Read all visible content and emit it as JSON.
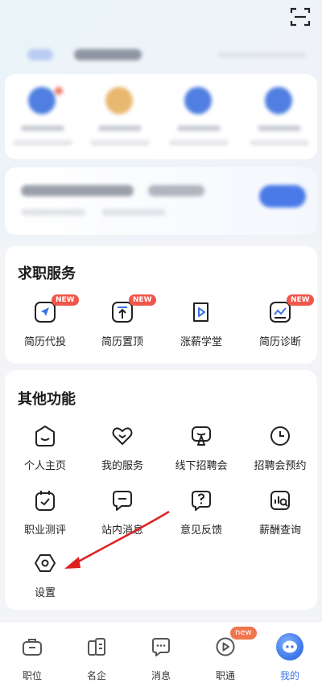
{
  "header": {
    "scan_icon": "scan-icon"
  },
  "service_section": {
    "title": "求职服务",
    "items": [
      {
        "label": "简历代投",
        "icon": "send-icon",
        "badge": "NEW"
      },
      {
        "label": "简历置顶",
        "icon": "pin-top-icon",
        "badge": "NEW"
      },
      {
        "label": "涨薪学堂",
        "icon": "play-book-icon",
        "badge": ""
      },
      {
        "label": "简历诊断",
        "icon": "diagnosis-icon",
        "badge": "NEW"
      }
    ]
  },
  "other_section": {
    "title": "其他功能",
    "items": [
      {
        "label": "个人主页",
        "icon": "home-face-icon"
      },
      {
        "label": "我的服务",
        "icon": "heart-icon"
      },
      {
        "label": "线下招聘会",
        "icon": "booth-icon"
      },
      {
        "label": "招聘会预约",
        "icon": "clock-icon"
      },
      {
        "label": "职业测评",
        "icon": "calendar-check-icon"
      },
      {
        "label": "站内消息",
        "icon": "message-icon"
      },
      {
        "label": "意见反馈",
        "icon": "question-icon"
      },
      {
        "label": "薪酬查询",
        "icon": "salary-search-icon"
      },
      {
        "label": "设置",
        "icon": "settings-icon"
      }
    ]
  },
  "tabbar": {
    "tabs": [
      {
        "label": "职位",
        "icon": "briefcase-icon"
      },
      {
        "label": "名企",
        "icon": "company-icon"
      },
      {
        "label": "消息",
        "icon": "chat-icon"
      },
      {
        "label": "职通",
        "icon": "play-circle-icon",
        "badge": "new"
      },
      {
        "label": "我的",
        "icon": "profile-avatar-icon",
        "active": true
      }
    ]
  },
  "colors": {
    "accent": "#3b74e8",
    "badge": "#f0564a",
    "annotation_arrow": "#e02020"
  }
}
